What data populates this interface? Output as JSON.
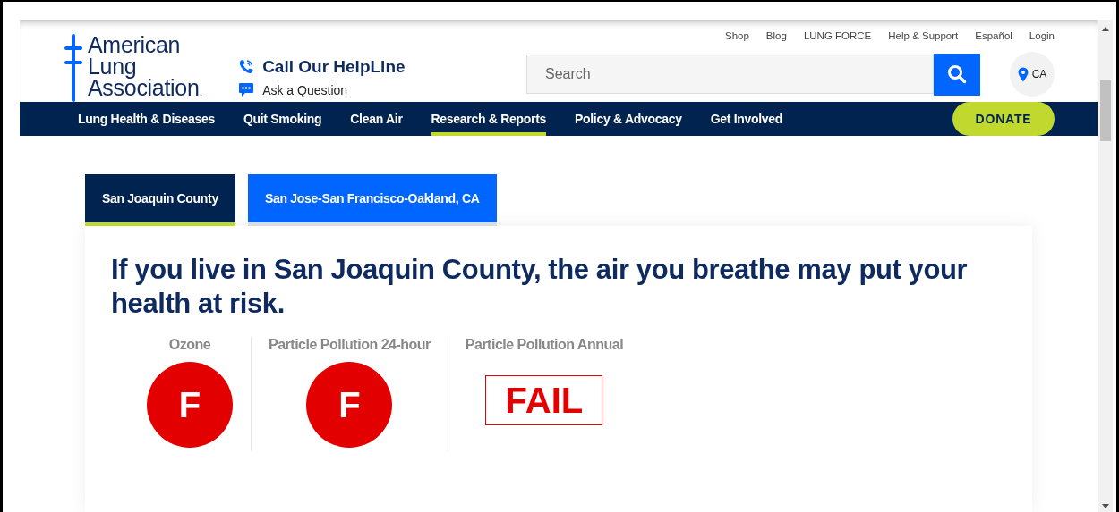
{
  "logo": {
    "lines": [
      "American",
      "Lung",
      "Association"
    ],
    "mark": "."
  },
  "helpline": {
    "title": "Call Our HelpLine",
    "ask": "Ask a Question"
  },
  "utility_links": [
    "Shop",
    "Blog",
    "LUNG FORCE",
    "Help & Support",
    "Español",
    "Login"
  ],
  "search": {
    "placeholder": "Search"
  },
  "location": {
    "label": "CA"
  },
  "nav": [
    {
      "label": "Lung Health & Diseases",
      "selected": false
    },
    {
      "label": "Quit Smoking",
      "selected": false
    },
    {
      "label": "Clean Air",
      "selected": false
    },
    {
      "label": "Research & Reports",
      "selected": true
    },
    {
      "label": "Policy & Advocacy",
      "selected": false
    },
    {
      "label": "Get Involved",
      "selected": false
    }
  ],
  "donate": "DONATE",
  "tabs": [
    {
      "label": "San Joaquin County",
      "selected": true
    },
    {
      "label": "San Jose-San Francisco-Oakland, CA",
      "selected": false
    }
  ],
  "headline": "If you live in San Joaquin County, the air you breathe may put your health at risk.",
  "grades": [
    {
      "title": "Ozone",
      "kind": "circle",
      "grade": "F"
    },
    {
      "title": "Particle Pollution 24-hour",
      "kind": "circle",
      "grade": "F"
    },
    {
      "title": "Particle Pollution Annual",
      "kind": "stamp",
      "grade": "FAIL"
    }
  ]
}
